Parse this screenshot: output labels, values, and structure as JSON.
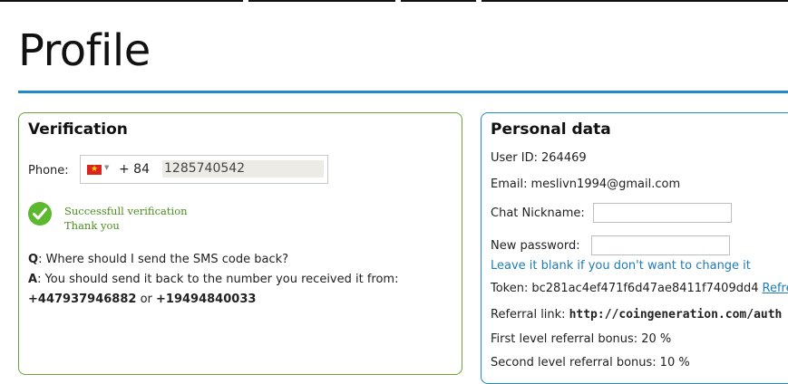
{
  "page": {
    "title": "Profile"
  },
  "verification": {
    "heading": "Verification",
    "phone_label": "Phone:",
    "flag_icon": "vietnam-flag-icon",
    "dial_code": "+ 84",
    "phone_number": "1285740542",
    "success_line1": "Successfull verification",
    "success_line2": "Thank you",
    "q_prefix": "Q",
    "q_text": ": Where should I send the SMS code back?",
    "a_prefix": "A",
    "a_text": ": You should send it back to the number you received it from:",
    "number1": "+447937946882",
    "or_text": " or ",
    "number2": "+19494840033",
    "colors": {
      "border": "#6aa33a",
      "success": "#4a8d1d",
      "check": "#5bb82f"
    }
  },
  "personal": {
    "heading": "Personal data",
    "user_id_label": "User ID:",
    "user_id_value": "264469",
    "email_label": "Email:",
    "email_value": "meslivn1994@gmail.com",
    "nickname_label": "Chat Nickname:",
    "nickname_value": "",
    "password_label": "New password:",
    "password_value": "",
    "password_hint": "Leave it blank if you don't want to change it",
    "token_label": "Token:",
    "token_value": "bc281ac4ef471f6d47ae8411f7409dd4",
    "token_refresh": "Refre",
    "referral_label": "Referral link:",
    "referral_value": "http://coingeneration.com/auth",
    "first_bonus_label": "First level referral bonus:",
    "first_bonus_value": "20 %",
    "second_bonus_label": "Second level referral bonus:",
    "second_bonus_value": "10 %",
    "colors": {
      "border": "#1f8ac6",
      "link": "#1f7cb3"
    }
  },
  "theme": {
    "accent": "#1f8ac6"
  }
}
